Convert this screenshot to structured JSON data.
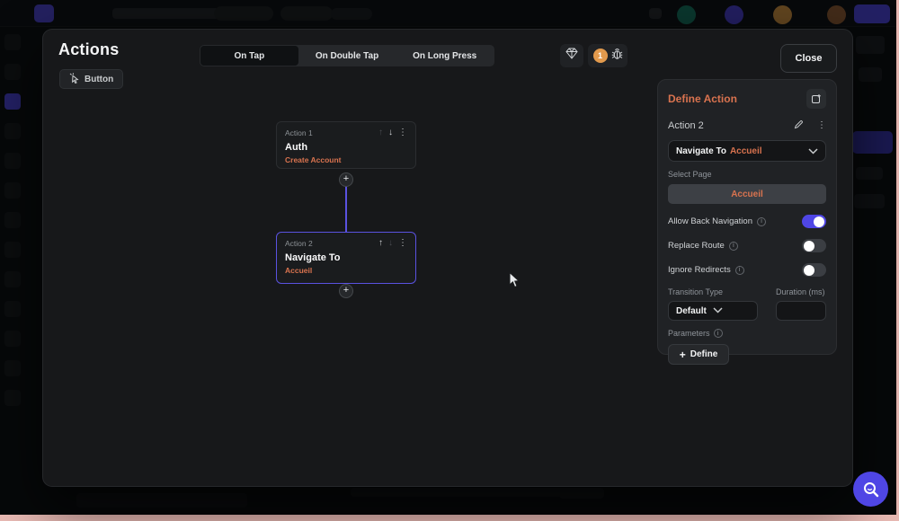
{
  "modal": {
    "title": "Actions",
    "widget_chip": "Button",
    "tabs": [
      {
        "label": "On Tap",
        "active": true
      },
      {
        "label": "On Double Tap",
        "active": false
      },
      {
        "label": "On Long Press",
        "active": false
      }
    ],
    "debug_badge": "1",
    "close_label": "Close"
  },
  "flow": {
    "nodes": [
      {
        "label": "Action 1",
        "type": "Auth",
        "subtitle": "Create Account",
        "selected": false
      },
      {
        "label": "Action 2",
        "type": "Navigate To",
        "subtitle": "Accueil",
        "selected": true
      }
    ],
    "add_label": "+"
  },
  "panel": {
    "title": "Define Action",
    "action_label": "Action 2",
    "action_type": "Navigate To",
    "action_target": "Accueil",
    "select_page_label": "Select Page",
    "selected_page": "Accueil",
    "toggles": [
      {
        "label": "Allow Back Navigation",
        "on": true
      },
      {
        "label": "Replace Route",
        "on": false
      },
      {
        "label": "Ignore Redirects",
        "on": false
      }
    ],
    "transition_type_label": "Transition Type",
    "transition_value": "Default",
    "duration_label": "Duration (ms)",
    "duration_value": "",
    "parameters_label": "Parameters",
    "define_button_label": "Define"
  },
  "colors": {
    "accent_orange": "#d9734f",
    "accent_purple": "#5a52e0",
    "toggle_on": "#4f46e5",
    "badge_orange": "#e29a4d"
  }
}
